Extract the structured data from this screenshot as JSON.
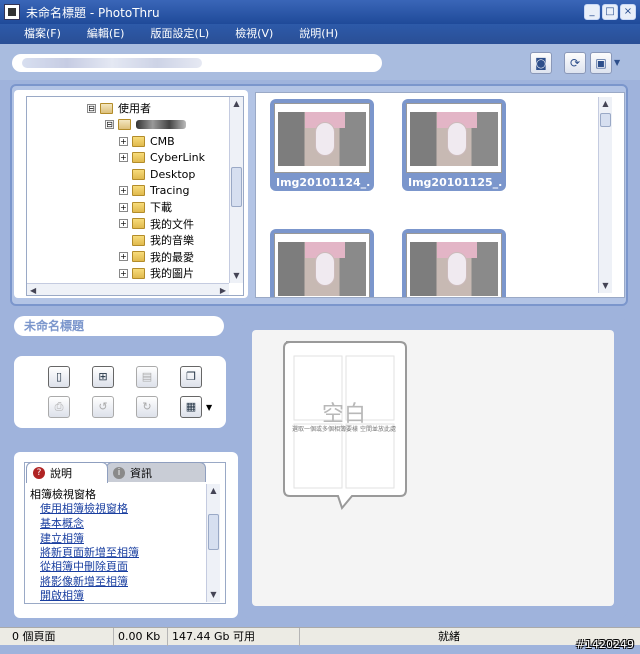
{
  "window": {
    "title": "未命名標題 - PhotoThru",
    "min": "_",
    "max": "□",
    "close": "×"
  },
  "menu": [
    "檔案(F)",
    "編輯(E)",
    "版面設定(L)",
    "檢視(V)",
    "說明(H)"
  ],
  "toolbar": {
    "icons": [
      "scan-icon",
      "refresh-icon",
      "view-icon"
    ]
  },
  "tree": {
    "items": [
      {
        "label": "使用者",
        "expander": "⊟",
        "indent": 0
      },
      {
        "label": "",
        "expander": "⊟",
        "indent": 1,
        "blurred": true
      },
      {
        "label": "CMB",
        "expander": "+",
        "indent": 2
      },
      {
        "label": "CyberLink",
        "expander": "+",
        "indent": 2
      },
      {
        "label": "Desktop",
        "expander": "",
        "indent": 2
      },
      {
        "label": "Tracing",
        "expander": "+",
        "indent": 2
      },
      {
        "label": "下載",
        "expander": "+",
        "indent": 2
      },
      {
        "label": "我的文件",
        "expander": "+",
        "indent": 2
      },
      {
        "label": "我的音樂",
        "expander": "",
        "indent": 2
      },
      {
        "label": "我的最愛",
        "expander": "+",
        "indent": 2
      },
      {
        "label": "我的圖片",
        "expander": "+",
        "indent": 2
      }
    ]
  },
  "thumbnails": [
    {
      "label": "Img20101124_..."
    },
    {
      "label": "Img20101125_..."
    },
    {
      "label": ""
    },
    {
      "label": ""
    }
  ],
  "album": {
    "title": "未命名標題",
    "empty_title": "空白",
    "empty_hint": "選取一個或多個相簿要樣 空間並放此處"
  },
  "help": {
    "tabs": [
      "說明",
      "資訊"
    ],
    "heading": "相簿檢視窗格",
    "links": [
      "使用相簿檢視窗格",
      "基本概念",
      "建立相簿",
      "將新頁面新增至相簿",
      "從相簿中刪除頁面",
      "將影像新增至相簿",
      "開啟相簿"
    ]
  },
  "status": {
    "pages": "0 個頁面",
    "size": "0.00 Kb",
    "free": "147.44 Gb 可用",
    "state": "就緒"
  },
  "watermark": "#1420249"
}
